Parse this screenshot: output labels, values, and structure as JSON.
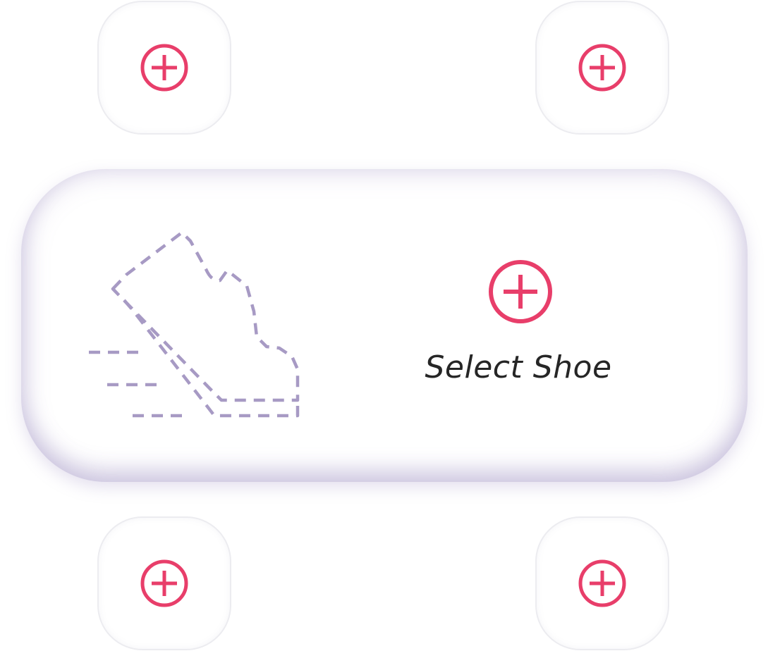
{
  "colors": {
    "accent": "#e83e6a",
    "shoe_outline": "#a79ac4",
    "label_text": "#262626",
    "card_glow": "#d9d2ea"
  },
  "slots": [
    {
      "position": "top-left",
      "icon": "plus-circle-icon"
    },
    {
      "position": "top-right",
      "icon": "plus-circle-icon"
    },
    {
      "position": "bottom-left",
      "icon": "plus-circle-icon"
    },
    {
      "position": "bottom-right",
      "icon": "plus-circle-icon"
    }
  ],
  "main_card": {
    "shoe_icon": "sneaker-outline-icon",
    "plus_icon": "plus-circle-icon",
    "label": "Select Shoe"
  }
}
